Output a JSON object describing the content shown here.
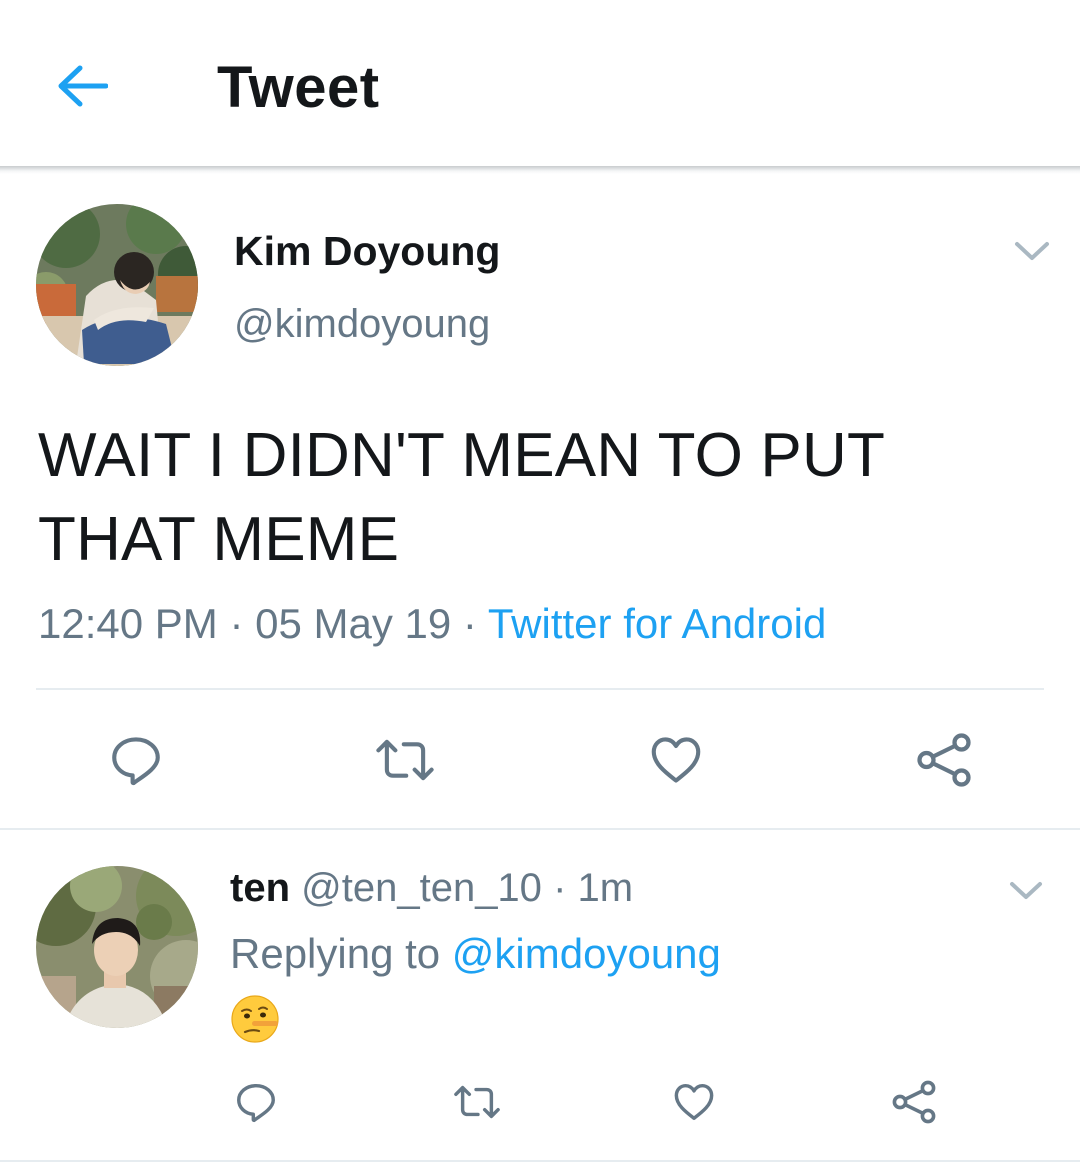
{
  "header": {
    "title": "Tweet",
    "back_icon": "arrow-left-icon",
    "accent_color": "#1da1f2"
  },
  "main_tweet": {
    "author_name": "Kim Doyoung",
    "author_handle": "@kimdoyoung",
    "text_line1": "WAIT I DIDN'T MEAN TO PUT",
    "text_line2": "THAT MEME",
    "time": "12:40 PM",
    "separator": "·",
    "date": "05 May 19",
    "source": "Twitter for Android",
    "actions": [
      "reply-icon",
      "retweet-icon",
      "like-icon",
      "share-icon"
    ]
  },
  "reply": {
    "author_name": "ten",
    "author_handle": "@ten_ten_10",
    "separator": "·",
    "age": "1m",
    "replying_prefix": "Replying to",
    "replying_to": "@kimdoyoung",
    "content_emoji": "🤥",
    "actions": [
      "reply-icon",
      "retweet-icon",
      "like-icon",
      "share-icon"
    ]
  },
  "colors": {
    "text_primary": "#14171a",
    "text_secondary": "#657786",
    "link": "#1da1f2",
    "divider": "#e6ecf0"
  }
}
